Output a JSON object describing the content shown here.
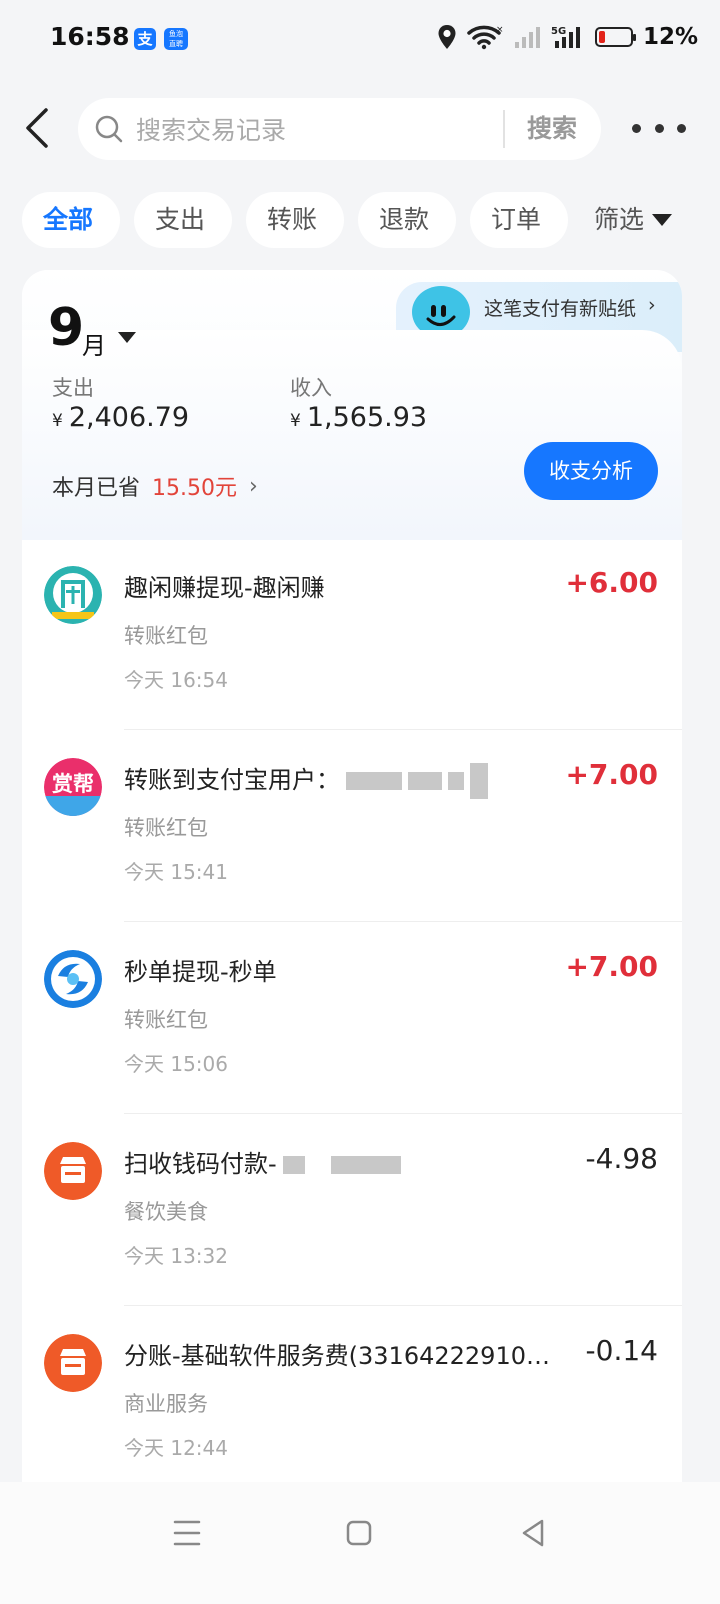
{
  "status_bar": {
    "time": "16:58",
    "app1_label": "支",
    "app2_label": "鱼泡\n直聘",
    "battery_text": "12%",
    "battery_level": 0.12,
    "network": "5G",
    "icons": [
      "location-icon",
      "wifi-icon",
      "signal-icon",
      "battery-icon"
    ]
  },
  "header": {
    "search_placeholder": "搜索交易记录",
    "search_button": "搜索"
  },
  "tabs": [
    {
      "label": "全部",
      "active": true
    },
    {
      "label": "支出",
      "active": false
    },
    {
      "label": "转账",
      "active": false
    },
    {
      "label": "退款",
      "active": false
    },
    {
      "label": "订单",
      "active": false
    }
  ],
  "filter_label": "筛选",
  "summary": {
    "sticker_text": "这笔支付有新贴纸",
    "month_number": "9",
    "month_unit": "月",
    "expense_label": "支出",
    "income_label": "收入",
    "currency": "¥",
    "expense_value": "2,406.79",
    "income_value": "1,565.93",
    "saved_label": "本月已省",
    "saved_amount": "15.50元",
    "analysis_button": "收支分析"
  },
  "transactions": [
    {
      "title": "趣闲赚提现-趣闲赚",
      "amount": "+6.00",
      "category": "转账红包",
      "time": "今天 16:54",
      "icon": "qxz-app-icon"
    },
    {
      "title": "转账到支付宝用户：",
      "amount": "+7.00",
      "category": "转账红包",
      "time": "今天 15:41",
      "icon": "shangbang-app-icon"
    },
    {
      "title": "秒单提现-秒单",
      "amount": "+7.00",
      "category": "转账红包",
      "time": "今天 15:06",
      "icon": "miaodan-app-icon"
    },
    {
      "title": "扫收钱码付款-",
      "amount": "-4.98",
      "category": "餐饮美食",
      "time": "今天 13:32",
      "icon": "store-icon"
    },
    {
      "title": "分账-基础软件服务费(331642229102...",
      "amount": "-0.14",
      "category": "商业服务",
      "time": "今天 12:44",
      "icon": "store-icon"
    }
  ],
  "colors": {
    "accent": "#1677ff",
    "income": "#e02f3a",
    "store_orange": "#ef5a28"
  }
}
